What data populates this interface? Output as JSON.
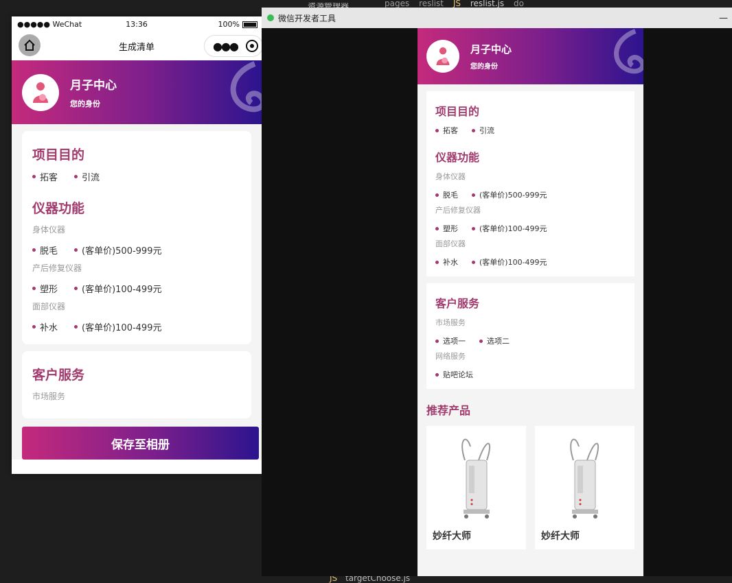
{
  "editor": {
    "explorer_label": "资源管理器",
    "breadcrumb": [
      "pages",
      "reslist",
      "reslist.js",
      "do"
    ],
    "bottom_file": "targetChoose.js",
    "js_badge": "JS"
  },
  "phone": {
    "status": {
      "carrier": "●●●●● WeChat",
      "time": "13:36",
      "battery": "100%"
    },
    "nav_title": "生成清单",
    "hero": {
      "title": "月子中心",
      "subtitle": "您的身份"
    },
    "purpose": {
      "title": "项目目的",
      "tags": [
        "拓客",
        "引流"
      ]
    },
    "features": {
      "title": "仪器功能",
      "groups": [
        {
          "label": "身体仪器",
          "tags": [
            "脱毛",
            "(客单价)500-999元"
          ]
        },
        {
          "label": "产后修复仪器",
          "tags": [
            "塑形",
            "(客单价)100-499元"
          ]
        },
        {
          "label": "面部仪器",
          "tags": [
            "补水",
            "(客单价)100-499元"
          ]
        }
      ]
    },
    "service": {
      "title": "客户服务",
      "groups": [
        {
          "label": "市场服务"
        }
      ]
    },
    "save_button": "保存至相册"
  },
  "devtools": {
    "title": "微信开发者工具",
    "hero": {
      "title": "月子中心",
      "subtitle": "您的身份"
    },
    "purpose": {
      "title": "项目目的",
      "tags": [
        "拓客",
        "引流"
      ]
    },
    "features": {
      "title": "仪器功能",
      "groups": [
        {
          "label": "身体仪器",
          "tags": [
            "脱毛",
            "(客单价)500-999元"
          ]
        },
        {
          "label": "产后修复仪器",
          "tags": [
            "塑形",
            "(客单价)100-499元"
          ]
        },
        {
          "label": "面部仪器",
          "tags": [
            "补水",
            "(客单价)100-499元"
          ]
        }
      ]
    },
    "service": {
      "title": "客户服务",
      "groups": [
        {
          "label": "市场服务",
          "tags": [
            "选项一",
            "选项二"
          ]
        },
        {
          "label": "网络服务",
          "tags": [
            "贴吧论坛"
          ]
        }
      ]
    },
    "recommend_title": "推荐产品",
    "products": [
      {
        "name": "妙纤大师"
      },
      {
        "name": "妙纤大师"
      }
    ]
  },
  "colors": {
    "accent": "#a13a6d",
    "gradient_start": "#c42a7c",
    "gradient_end": "#2c148e"
  }
}
